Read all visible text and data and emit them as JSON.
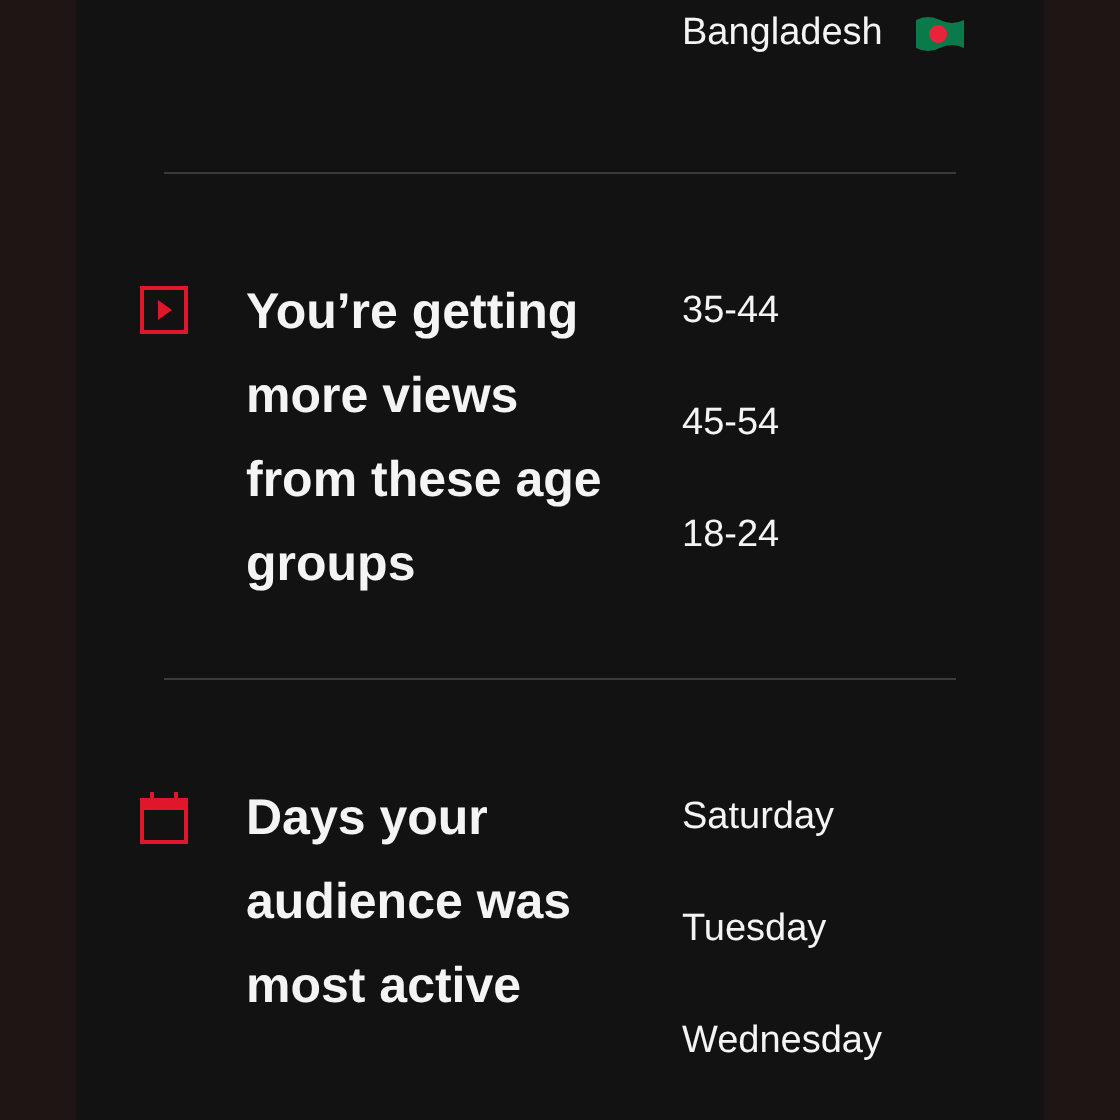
{
  "sections": [
    {
      "items": [
        {
          "label": "Bangladesh",
          "kind": "flag"
        }
      ]
    },
    {
      "kind": "views",
      "heading": "You’re getting more views from these age groups",
      "items": [
        {
          "label": "35-44",
          "kind": "text"
        },
        {
          "label": "45-54",
          "kind": "text"
        },
        {
          "label": "18-24",
          "kind": "text"
        }
      ]
    },
    {
      "kind": "days",
      "heading": "Days your audience was most active",
      "items": [
        {
          "label": "Saturday",
          "kind": "text"
        },
        {
          "label": "Tuesday",
          "kind": "text"
        },
        {
          "label": "Wednesday",
          "kind": "text"
        }
      ]
    }
  ]
}
